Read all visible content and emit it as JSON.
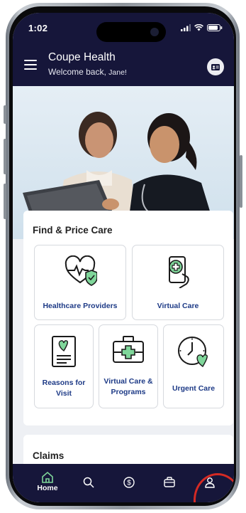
{
  "status": {
    "time": "1:02"
  },
  "header": {
    "app_title": "Coupe Health",
    "welcome_prefix": "Welcome back,",
    "welcome_name": "Jane!"
  },
  "find_price": {
    "title": "Find & Price Care",
    "tiles": [
      {
        "label": "Healthcare Providers",
        "icon": "heart-pulse-shield-icon"
      },
      {
        "label": "Virtual Care",
        "icon": "phone-medical-cross-icon"
      },
      {
        "label": "Reasons for Visit",
        "icon": "clipboard-heart-icon"
      },
      {
        "label": "Virtual Care & Programs",
        "icon": "medical-kit-icon"
      },
      {
        "label": "Urgent Care",
        "icon": "clock-heart-icon"
      }
    ]
  },
  "claims": {
    "title": "Claims"
  },
  "tabbar": {
    "items": [
      {
        "label": "Home",
        "icon": "home-icon",
        "active": true
      },
      {
        "label": "",
        "icon": "search-icon"
      },
      {
        "label": "",
        "icon": "dollar-icon"
      },
      {
        "label": "",
        "icon": "briefcase-icon"
      },
      {
        "label": "",
        "icon": "profile-icon"
      }
    ]
  },
  "colors": {
    "header_bg": "#16163a",
    "accent": "#1d3a86",
    "icon_green": "#7fd69a",
    "highlight": "#d42a24"
  }
}
